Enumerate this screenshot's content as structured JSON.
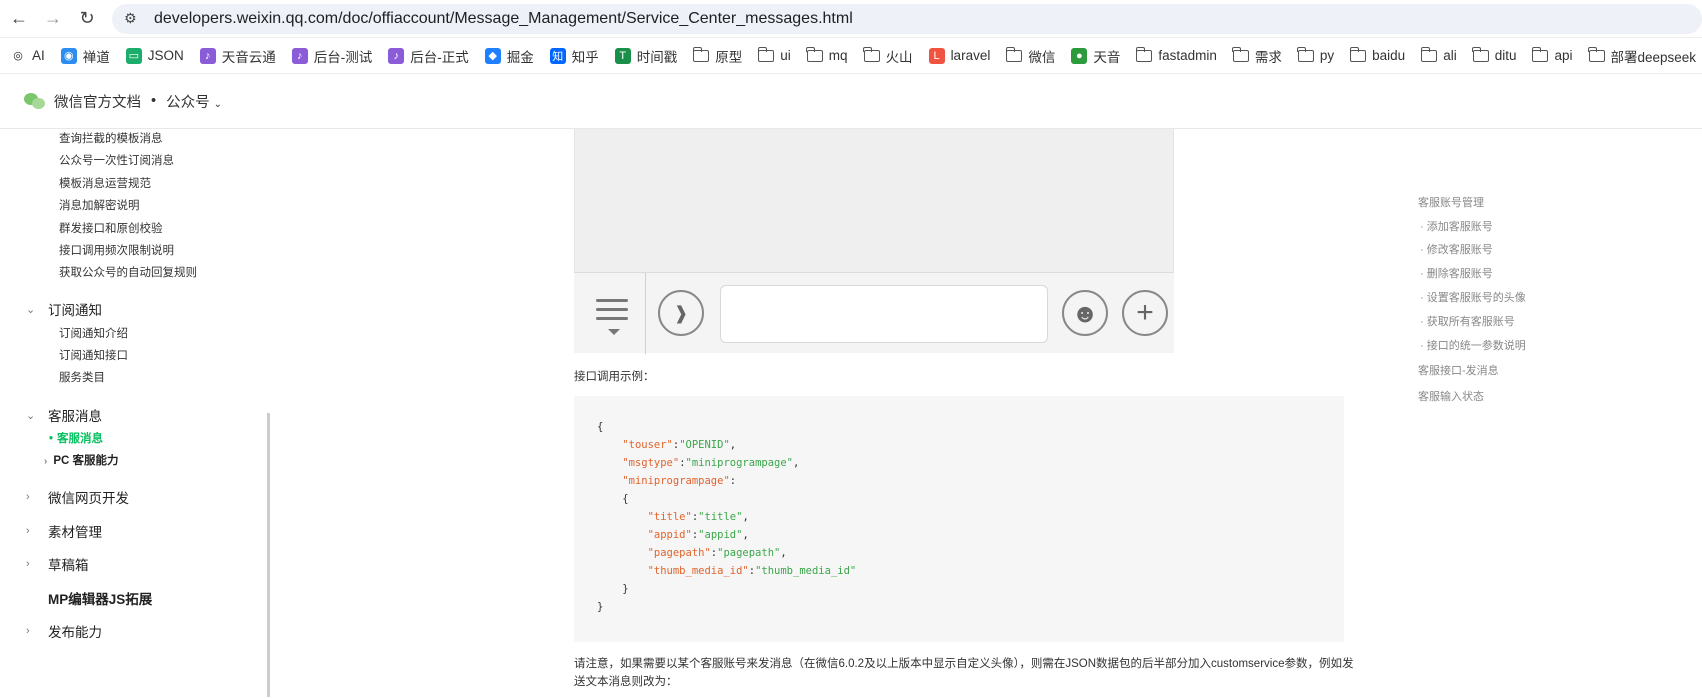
{
  "browser": {
    "url": "developers.weixin.qq.com/doc/offiaccount/Message_Management/Service_Center_messages.html",
    "bookmarks": [
      "AI",
      "禅道",
      "JSON",
      "天音云通",
      "后台-测试",
      "后台-正式",
      "掘金",
      "知乎",
      "时间戳",
      "原型",
      "ui",
      "mq",
      "火山",
      "laravel",
      "微信",
      "天音",
      "fastadmin",
      "需求",
      "py",
      "baidu",
      "ali",
      "ditu",
      "api",
      "部署deepseek"
    ]
  },
  "site": {
    "title": "微信官方文档",
    "section": "公众号"
  },
  "sidebar": {
    "template_items": [
      "查询拦截的模板消息",
      "公众号一次性订阅消息",
      "模板消息运营规范",
      "消息加解密说明",
      "群发接口和原创校验",
      "接口调用频次限制说明",
      "获取公众号的自动回复规则"
    ],
    "subscribe_title": "订阅通知",
    "subscribe_items": [
      "订阅通知介绍",
      "订阅通知接口",
      "服务类目"
    ],
    "kefu_title": "客服消息",
    "kefu_active": "客服消息",
    "kefu_pc": "PC 客服能力",
    "sections": [
      "微信网页开发",
      "素材管理",
      "草稿箱",
      "MP编辑器JS拓展",
      "发布能力"
    ]
  },
  "content": {
    "example_label": "接口调用示例：",
    "code_lines": [
      {
        "indent": 0,
        "text": "{"
      },
      {
        "indent": 1,
        "key": "\"touser\"",
        "val": "\"OPENID\"",
        "tail": ","
      },
      {
        "indent": 1,
        "key": "\"msgtype\"",
        "val": "\"miniprogrampage\"",
        "tail": ","
      },
      {
        "indent": 1,
        "key": "\"miniprogrampage\"",
        "val": "",
        "tail": ":"
      },
      {
        "indent": 1,
        "text": "{"
      },
      {
        "indent": 2,
        "key": "\"title\"",
        "val": "\"title\"",
        "tail": ","
      },
      {
        "indent": 2,
        "key": "\"appid\"",
        "val": "\"appid\"",
        "tail": ","
      },
      {
        "indent": 2,
        "key": "\"pagepath\"",
        "val": "\"pagepath\"",
        "tail": ","
      },
      {
        "indent": 2,
        "key": "\"thumb_media_id\"",
        "val": "\"thumb_media_id\"",
        "tail": ""
      },
      {
        "indent": 1,
        "text": "}"
      },
      {
        "indent": 0,
        "text": "}"
      }
    ],
    "note": "请注意，如果需要以某个客服账号来发消息（在微信6.0.2及以上版本中显示自定义头像），则需在JSON数据包的后半部分加入customservice参数，例如发送文本消息则改为："
  },
  "toc": {
    "items": [
      {
        "text": "客服账号管理",
        "child": false
      },
      {
        "text": "· 添加客服账号",
        "child": true
      },
      {
        "text": "· 修改客服账号",
        "child": true
      },
      {
        "text": "· 删除客服账号",
        "child": true
      },
      {
        "text": "· 设置客服账号的头像",
        "child": true
      },
      {
        "text": "· 获取所有客服账号",
        "child": true
      },
      {
        "text": "· 接口的统一参数说明",
        "child": true
      },
      {
        "text": "客服接口-发消息",
        "child": false
      },
      {
        "text": "客服输入状态",
        "child": false
      }
    ]
  },
  "colors": {
    "accent": "#07c160",
    "code_key": "#e0632d",
    "code_string": "#3aa64a"
  }
}
